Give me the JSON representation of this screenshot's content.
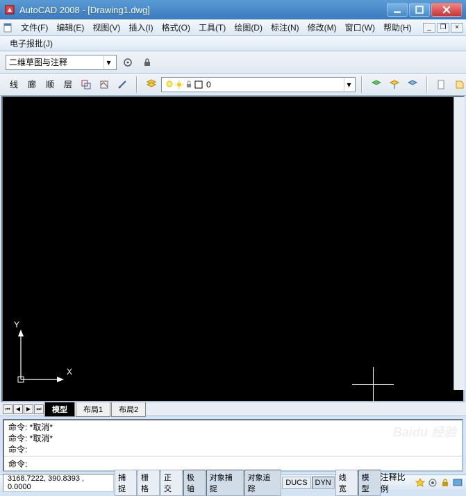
{
  "title": "AutoCAD 2008 - [Drawing1.dwg]",
  "menu": {
    "file": "文件(F)",
    "edit": "编辑(E)",
    "view": "视图(V)",
    "insert": "插入(I)",
    "format": "格式(O)",
    "tools": "工具(T)",
    "draw": "绘图(D)",
    "dimension": "标注(N)",
    "modify": "修改(M)",
    "window": "窗口(W)",
    "help": "帮助(H)",
    "approve": "电子报批(J)"
  },
  "workspace": {
    "value": "二维草图与注释"
  },
  "layer": {
    "current": "0"
  },
  "ucs": {
    "x": "X",
    "y": "Y"
  },
  "tabs": {
    "model": "模型",
    "layout1": "布局1",
    "layout2": "布局2"
  },
  "command": {
    "line1": "命令: *取消*",
    "line2": "命令: *取消*",
    "line3": "命令:",
    "prompt": "命令:"
  },
  "status": {
    "coords": "3168.7222, 390.8393 , 0.0000",
    "snap": "捕捉",
    "grid": "栅格",
    "ortho": "正交",
    "polar": "极轴",
    "osnap": "对象捕捉",
    "otrack": "对象追踪",
    "ducs": "DUCS",
    "dyn": "DYN",
    "lwt": "线宽",
    "model": "模型",
    "annoscale": "注释比例"
  },
  "watermark": "Baidu 经验"
}
